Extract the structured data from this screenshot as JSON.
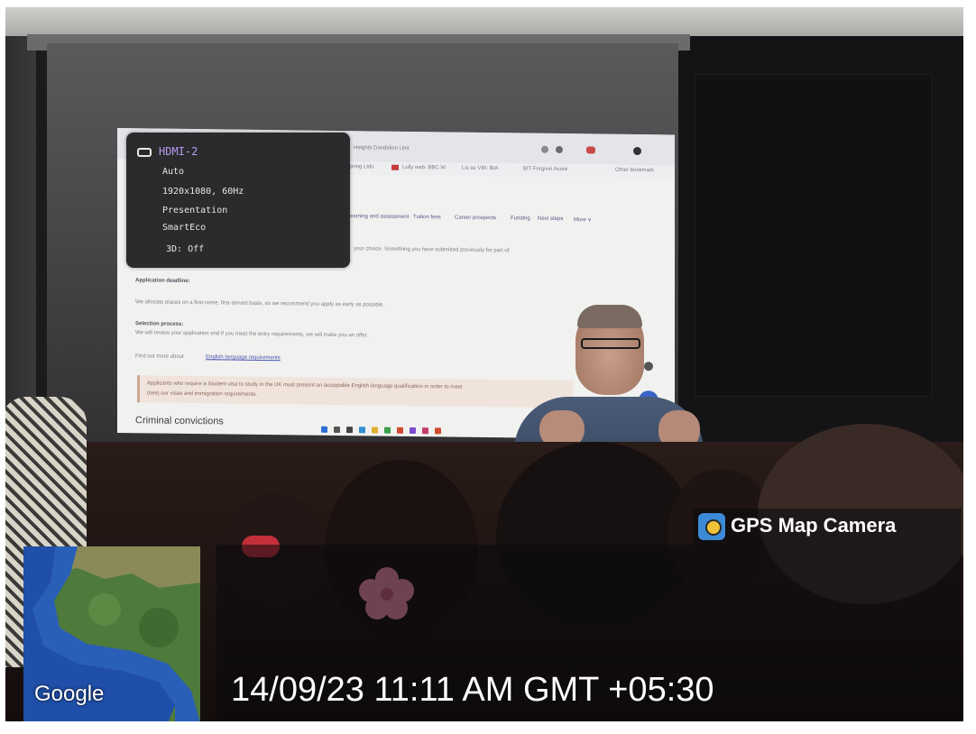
{
  "osd": {
    "source": "HDMI-2",
    "lines": [
      "Auto",
      "1920x1080, 60Hz",
      "Presentation",
      "SmartEco",
      "3D:  Off"
    ],
    "source_color": "#b79cf0"
  },
  "projection": {
    "nav_items": [
      "earning and assessment",
      "Tuition fees",
      "Career prospects",
      "Funding",
      "Next steps",
      "More ∨"
    ],
    "intro_text": "your choice. Something you have submitted previously for part of",
    "application_head": "Application deadline:",
    "application_text": "We allocate places on a first-come, first-served basis, so we recommend you apply as early as possible.",
    "selection_head": "Selection process:",
    "selection_text": "We will review your application and if you meet the entry requirements, we will make you an offer.",
    "find_out_text": "Find out more about",
    "english_link": "English language requirements",
    "notice_text": "Applicants who require a Student visa to study in the UK must present an acceptable English language qualification in order to meet",
    "notice_text_2": "(see) our visas and immigration requirements.",
    "section_title": "Criminal convictions"
  },
  "gps": {
    "brand": "GPS Map Camera",
    "map_label": "Google",
    "timestamp": "14/09/23 11:11 AM GMT +05:30",
    "accent": "#3c8ad6"
  }
}
